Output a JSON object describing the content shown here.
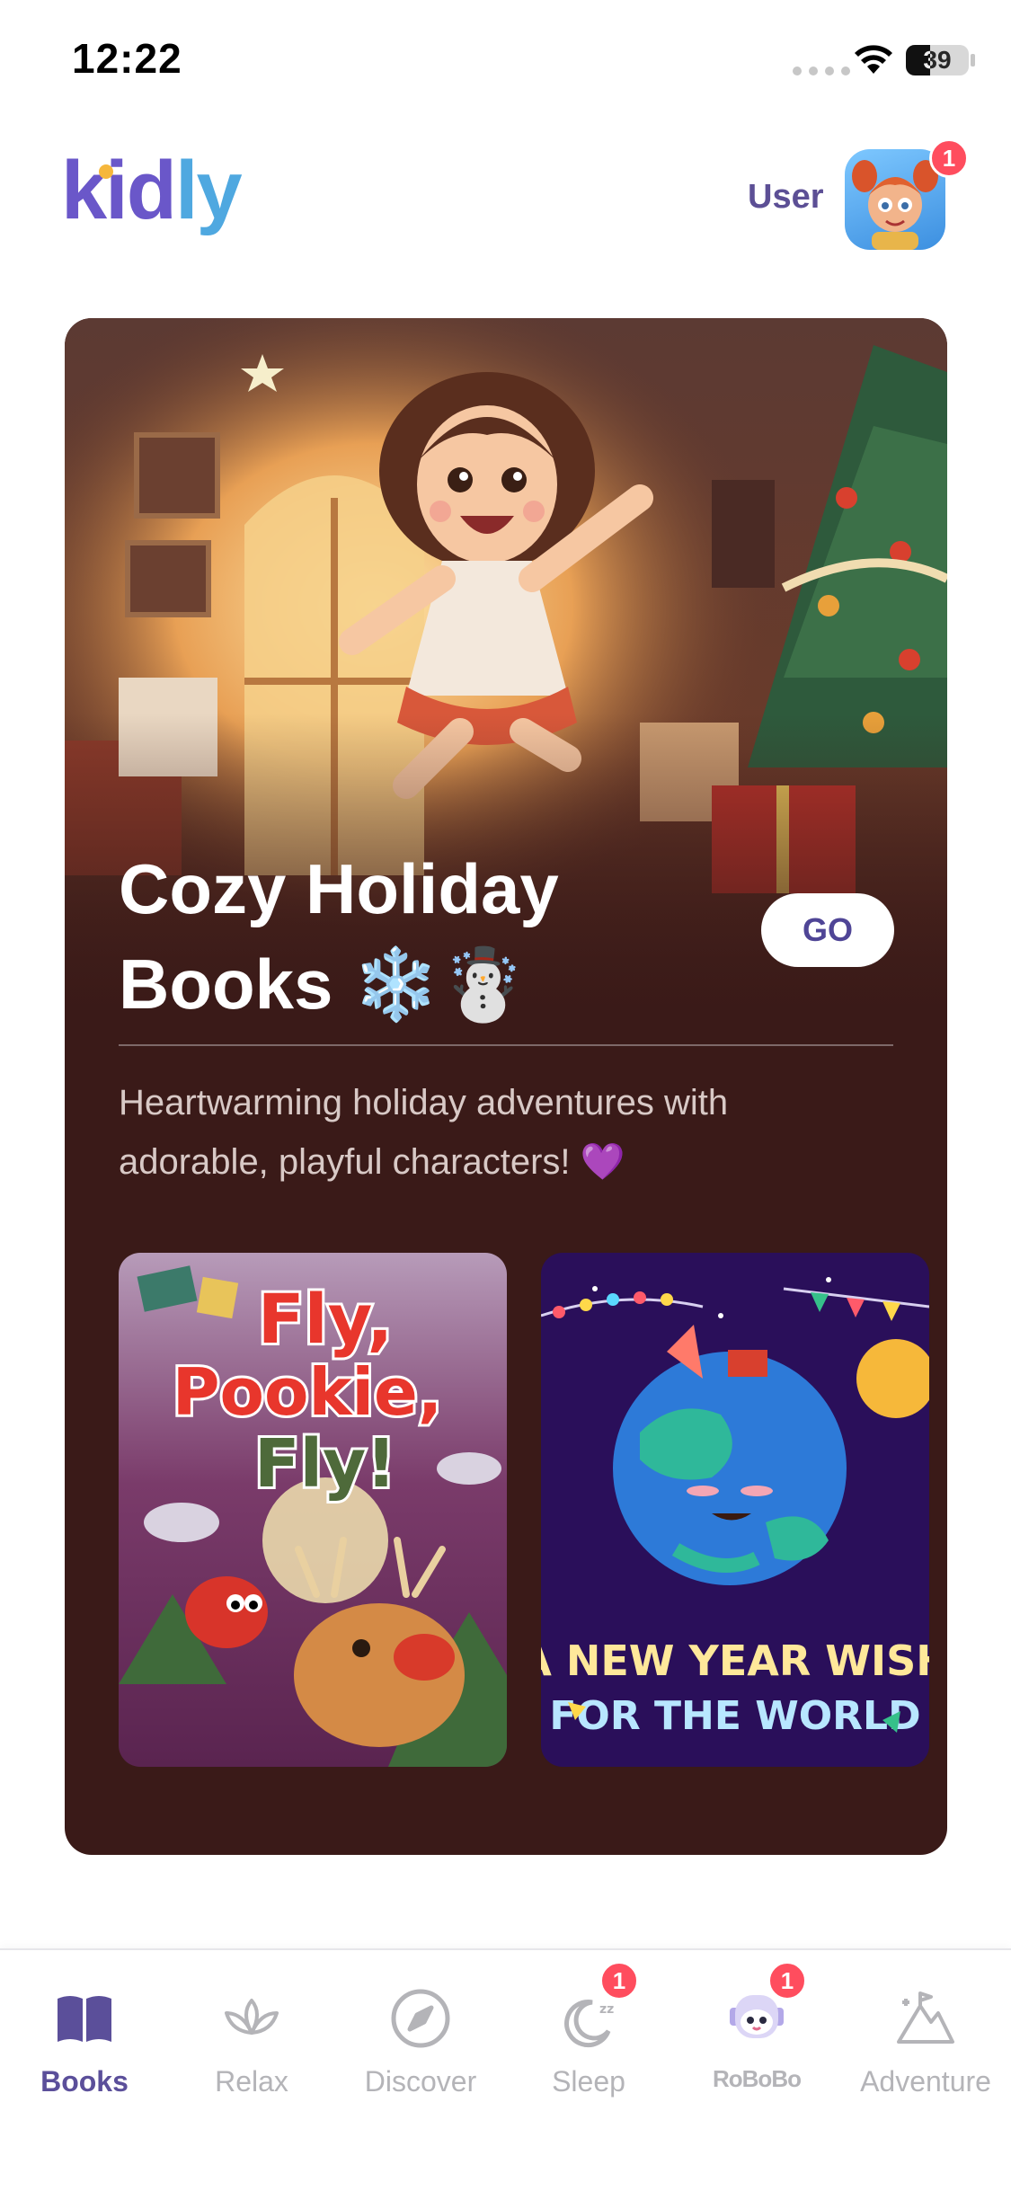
{
  "status_bar": {
    "time": "12:22",
    "battery": "39"
  },
  "header": {
    "logo": "kidly",
    "logo_part1": "kid",
    "logo_part2": "ly",
    "user_label": "User",
    "notification_count": "1"
  },
  "hero": {
    "title_line1": "Cozy Holiday",
    "title_line2": "Books ❄️☃️",
    "go_label": "GO",
    "description": "Heartwarming holiday adventures with adorable, playful characters! 💜",
    "books": [
      {
        "title_lines": [
          "Fly,",
          "Pookie,",
          "Fly!"
        ]
      },
      {
        "title_line1": "A NEW YEAR WISH",
        "title_line2": "FOR THE WORLD"
      }
    ]
  },
  "tabs": [
    {
      "label": "Books",
      "icon": "book-icon",
      "active": true
    },
    {
      "label": "Relax",
      "icon": "lotus-icon"
    },
    {
      "label": "Discover",
      "icon": "compass-icon"
    },
    {
      "label": "Sleep",
      "icon": "moon-icon",
      "badge": "1"
    },
    {
      "label": "RoBoBo",
      "icon": "robot-icon",
      "badge": "1"
    },
    {
      "label": "Adventure",
      "icon": "mountain-icon"
    }
  ],
  "colors": {
    "accent": "#5b4f9a",
    "card_bg": "#3a1a18",
    "badge": "#ff4d5e"
  }
}
